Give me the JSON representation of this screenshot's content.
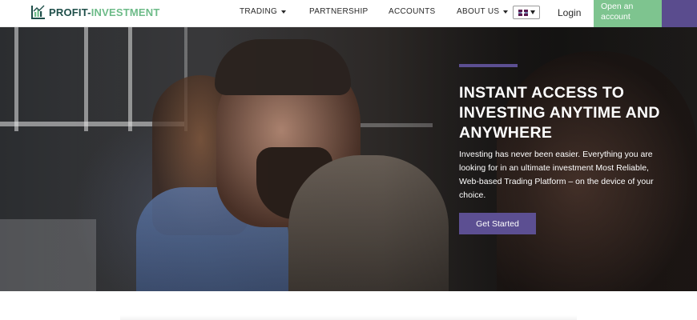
{
  "header": {
    "logo": {
      "text_main": "PROFIT-",
      "text_accent": "INVESTMENT",
      "icon": "bar-chart-logo-icon"
    },
    "nav": [
      {
        "label": "TRADING",
        "has_dropdown": true
      },
      {
        "label": "PARTNERSHIP",
        "has_dropdown": false
      },
      {
        "label": "ACCOUNTS",
        "has_dropdown": false
      },
      {
        "label": "ABOUT US",
        "has_dropdown": true
      }
    ],
    "language": {
      "icon": "uk-flag-icon"
    },
    "login_label": "Login",
    "open_account_label": "Open an account"
  },
  "hero": {
    "title": "INSTANT ACCESS TO INVESTING ANYTIME AND ANYWHERE",
    "text": "Investing has never been easier. Everything you are looking for in an ultimate investment Most Reliable, Web-based Trading Platform – on the device of your choice.",
    "cta_label": "Get Started"
  },
  "colors": {
    "brand_green": "#7ec48f",
    "brand_purple": "#5c4f92",
    "logo_dark": "#1f4f4a"
  }
}
